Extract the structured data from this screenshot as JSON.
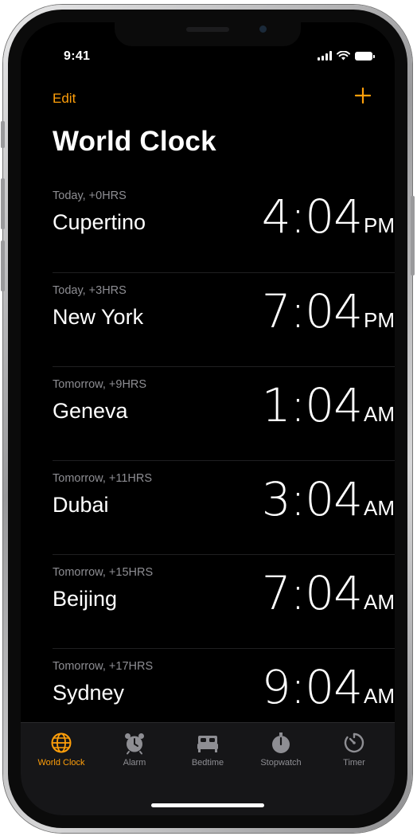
{
  "status_bar": {
    "time": "9:41"
  },
  "nav": {
    "edit_label": "Edit",
    "add_icon": "plus-icon",
    "accent_color": "#ff9f0a"
  },
  "page": {
    "title": "World Clock"
  },
  "clocks": [
    {
      "offset": "Today, +0HRS",
      "city": "Cupertino",
      "time": "4:04",
      "ampm": "PM"
    },
    {
      "offset": "Today, +3HRS",
      "city": "New York",
      "time": "7:04",
      "ampm": "PM"
    },
    {
      "offset": "Tomorrow, +9HRS",
      "city": "Geneva",
      "time": "1:04",
      "ampm": "AM"
    },
    {
      "offset": "Tomorrow, +11HRS",
      "city": "Dubai",
      "time": "3:04",
      "ampm": "AM"
    },
    {
      "offset": "Tomorrow, +15HRS",
      "city": "Beijing",
      "time": "7:04",
      "ampm": "AM"
    },
    {
      "offset": "Tomorrow, +17HRS",
      "city": "Sydney",
      "time": "9:04",
      "ampm": "AM"
    }
  ],
  "tab_bar": {
    "tabs": [
      {
        "label": "World Clock",
        "icon": "globe-icon",
        "active": true
      },
      {
        "label": "Alarm",
        "icon": "alarm-clock-icon",
        "active": false
      },
      {
        "label": "Bedtime",
        "icon": "bed-icon",
        "active": false
      },
      {
        "label": "Stopwatch",
        "icon": "stopwatch-icon",
        "active": false
      },
      {
        "label": "Timer",
        "icon": "timer-icon",
        "active": false
      }
    ]
  }
}
